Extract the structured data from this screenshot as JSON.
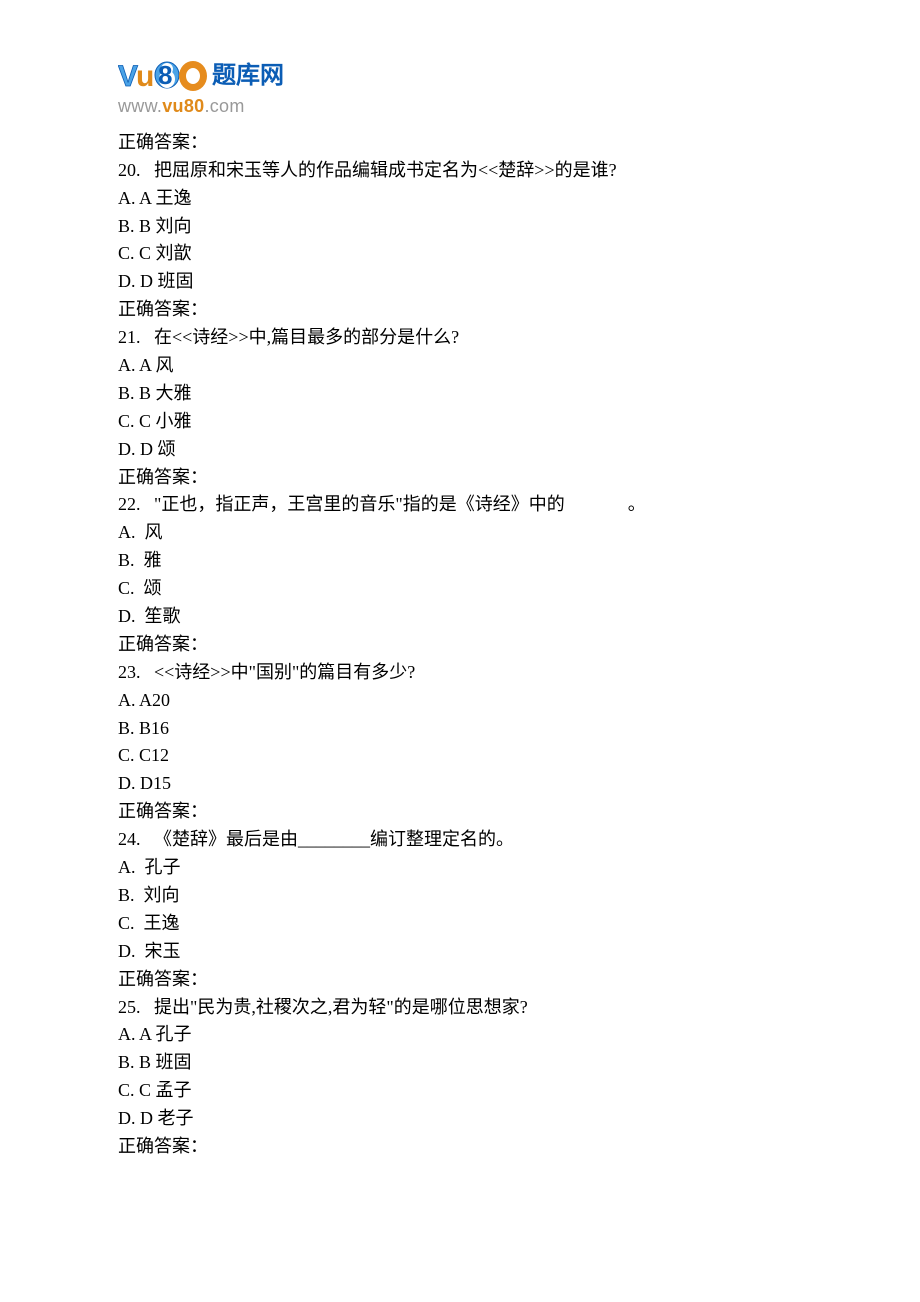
{
  "logo": {
    "cn": "题库网",
    "url_plain": "www.",
    "url_accent": "vu80",
    "url_tail": ".com"
  },
  "intro_answer": "正确答案：",
  "questions": [
    {
      "num": "20.",
      "text": "   把屈原和宋玉等人的作品编辑成书定名为<<楚辞>>的是谁?",
      "opts": [
        "A. A 王逸",
        "B. B 刘向",
        "C. C 刘歆",
        "D. D 班固"
      ],
      "ans": "正确答案："
    },
    {
      "num": "21.",
      "text": "   在<<诗经>>中,篇目最多的部分是什么?",
      "opts": [
        "A. A 风",
        "B. B 大雅",
        "C. C 小雅",
        "D. D 颂"
      ],
      "ans": "正确答案："
    },
    {
      "num": "22.",
      "text": "   \"正也，指正声，王宫里的音乐\"指的是《诗经》中的              。",
      "opts": [
        "A.  风",
        "B.  雅",
        "C.  颂",
        "D.  笙歌"
      ],
      "ans": "正确答案："
    },
    {
      "num": "23.",
      "text": "   <<诗经>>中\"国别\"的篇目有多少?",
      "opts": [
        "A. A20",
        "B. B16",
        "C. C12",
        "D. D15"
      ],
      "ans": "正确答案："
    },
    {
      "num": "24.",
      "text": "   《楚辞》最后是由________编订整理定名的。",
      "opts": [
        "A.  孔子",
        "B.  刘向",
        "C.  王逸",
        "D.  宋玉"
      ],
      "ans": "正确答案："
    },
    {
      "num": "25.",
      "text": "   提出\"民为贵,社稷次之,君为轻\"的是哪位思想家?",
      "opts": [
        "A. A 孔子",
        "B. B 班固",
        "C. C 孟子",
        "D. D 老子"
      ],
      "ans": "正确答案："
    }
  ]
}
